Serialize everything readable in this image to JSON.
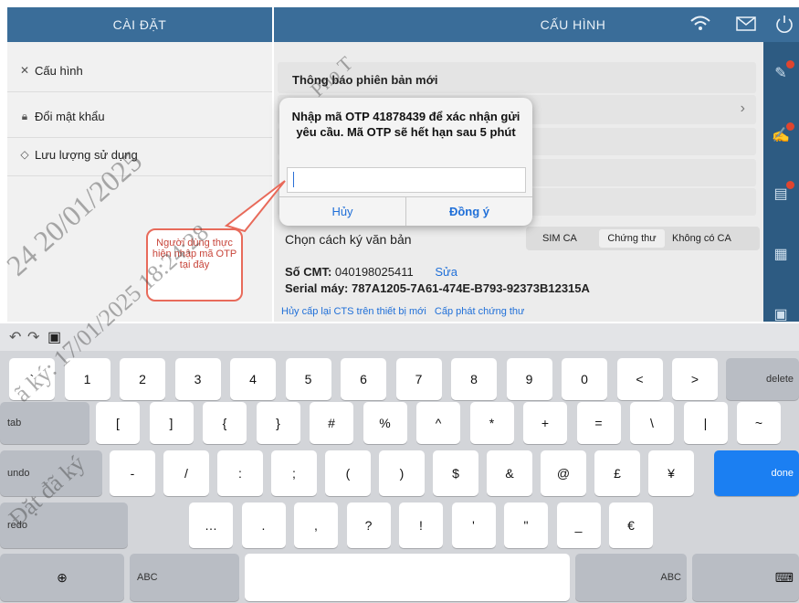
{
  "sidebar": {
    "title": "CÀI ĐẶT",
    "items": [
      {
        "label": "Cấu hình",
        "icon": "tools-icon"
      },
      {
        "label": "Đổi mật khẩu",
        "icon": "lock-icon"
      },
      {
        "label": "Lưu lượng sử dụng",
        "icon": "data-usage-icon"
      }
    ]
  },
  "main": {
    "title": "CẤU HÌNH",
    "notify_label": "Thông báo phiên bản mới",
    "sign_method_label": "Chọn cách ký văn bản",
    "sign_options": [
      "SIM CA",
      "Chứng thư",
      "Không có CA"
    ],
    "cmt_label": "Số CMT:",
    "cmt_value": "040198025411",
    "edit_link": "Sửa",
    "serial_label": "Serial máy:",
    "serial_value": "787A1205-7A61-474E-B793-92373B12315A",
    "revoke_link": "Hủy cấp lại CTS trên thiết bị mới",
    "issue_link": "Cấp phát chứng thư"
  },
  "dialog": {
    "message": "Nhập mã OTP 41878439 để xác nhận gửi yêu cầu. Mã OTP sẽ hết hạn sau 5 phút",
    "cancel_label": "Hủy",
    "ok_label": "Đồng ý"
  },
  "callout": {
    "text": "Người dùng thực hiện nhập mã OTP tại đây"
  },
  "keyboard": {
    "row1": [
      "`",
      "1",
      "2",
      "3",
      "4",
      "5",
      "6",
      "7",
      "8",
      "9",
      "0",
      "<",
      ">"
    ],
    "delete_label": "delete",
    "tab_label": "tab",
    "row2": [
      "[",
      "]",
      "{",
      "}",
      "#",
      "%",
      "^",
      "*",
      "+",
      "=",
      "\\",
      "|",
      "~"
    ],
    "undo_label": "undo",
    "row3": [
      "-",
      "/",
      ":",
      ";",
      "(",
      ")",
      "$",
      "&",
      "@",
      "£",
      "¥"
    ],
    "done_label": "done",
    "redo_label": "redo",
    "row4": [
      "…",
      ".",
      ",",
      "?",
      "!",
      "'",
      "\"",
      "_",
      "€"
    ],
    "abc_left": "ABC",
    "abc_right": "ABC"
  },
  "watermark": {
    "line1": "24 20/01/2025",
    "line2": "ã ký: 17/01/2025 18:24:28",
    "line3": "Đặt đã ký",
    "line4": "Pho T"
  },
  "colors": {
    "header": "#3a6d99",
    "rail": "#2d5b82",
    "accent": "#1f6fd8",
    "callout": "#e86a5a"
  }
}
